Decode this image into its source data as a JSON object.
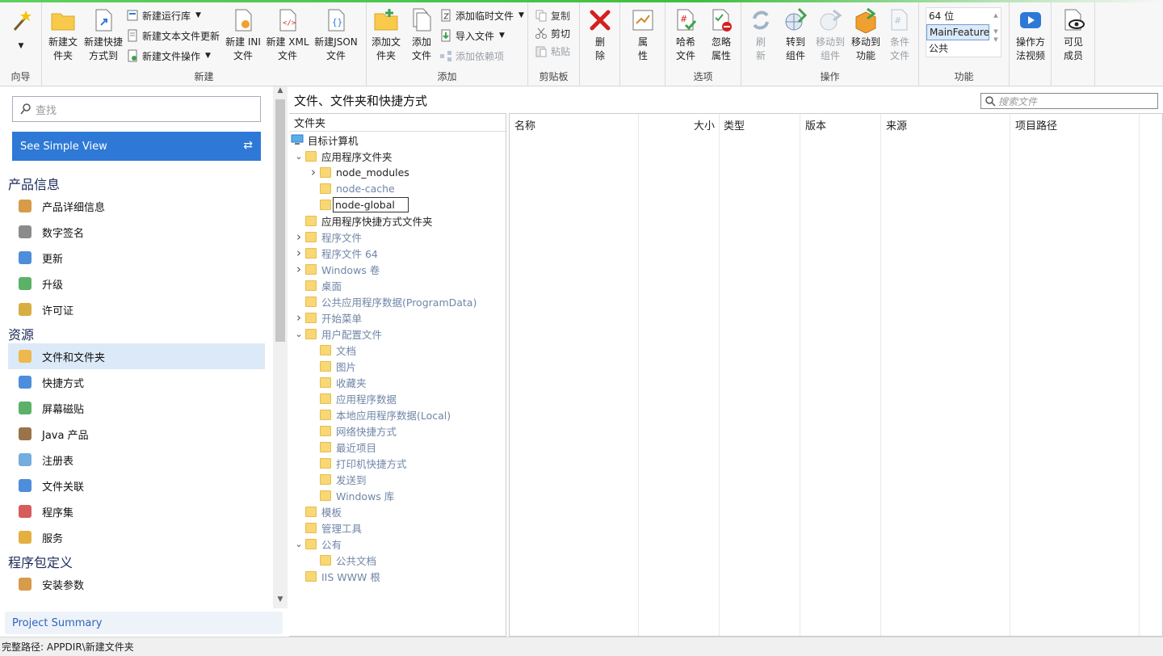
{
  "ribbon": {
    "wizard": {
      "label": "向导"
    },
    "new_group": {
      "label": "新建",
      "new_folder": "新建文\n件夹",
      "new_shortcut": "新建快捷\n方式到",
      "new_runtime": "新建运行库",
      "new_text_update": "新建文本文件更新",
      "new_file_op": "新建文件操作",
      "new_ini": "新建 INI\n文件",
      "new_xml": "新建 XML\n文件",
      "new_json": "新建JSON\n文件"
    },
    "add_group": {
      "label": "添加",
      "add_folder": "添加文\n件夹",
      "add_file": "添加\n文件",
      "add_temp": "添加临时文件",
      "import_file": "导入文件",
      "add_dependency": "添加依赖项"
    },
    "clipboard": {
      "label": "剪贴板",
      "copy": "复制",
      "cut": "剪切",
      "paste": "粘贴"
    },
    "delete": "删\n除",
    "properties": "属\n性",
    "options": {
      "label": "选项",
      "hash": "哈希\n文件",
      "ignore": "忽略\n属性"
    },
    "actions": {
      "label": "操作",
      "refresh": "刷\n新",
      "goto_component": "转到\n组件",
      "move_component": "移动到\n组件",
      "move_feature": "移动到\n功能",
      "condition": "条件\n文件"
    },
    "features": {
      "label": "功能",
      "items": [
        "64 位",
        "MainFeature",
        "公共"
      ]
    },
    "video": "操作方\n法视频",
    "visible_members": "可见\n成员"
  },
  "sidebar": {
    "search_placeholder": "查找",
    "simple_view": "See Simple View",
    "sections": [
      {
        "title": "产品信息",
        "items": [
          "产品详细信息",
          "数字签名",
          "更新",
          "升级",
          "许可证"
        ]
      },
      {
        "title": "资源",
        "items": [
          "文件和文件夹",
          "快捷方式",
          "屏幕磁贴",
          "Java 产品",
          "注册表",
          "文件关联",
          "程序集",
          "服务"
        ]
      },
      {
        "title": "程序包定义",
        "items": [
          "安装参数"
        ]
      }
    ],
    "project_summary": "Project Summary"
  },
  "main": {
    "title": "文件、文件夹和快捷方式",
    "search_placeholder": "搜索文件",
    "tree_header": "文件夹",
    "tree": [
      {
        "label": "目标计算机",
        "level": 0,
        "exp": "",
        "type": "computer",
        "dim": false
      },
      {
        "label": "应用程序文件夹",
        "level": 1,
        "exp": "v",
        "type": "folder",
        "dim": false
      },
      {
        "label": "node_modules",
        "level": 2,
        "exp": ">",
        "type": "folder",
        "dim": false
      },
      {
        "label": "node-cache",
        "level": 2,
        "exp": "",
        "type": "folder",
        "dim": true
      },
      {
        "label": "node-global",
        "level": 2,
        "exp": "",
        "type": "edit",
        "dim": false
      },
      {
        "label": "应用程序快捷方式文件夹",
        "level": 1,
        "exp": "",
        "type": "folder",
        "dim": false
      },
      {
        "label": "程序文件",
        "level": 1,
        "exp": ">",
        "type": "folder",
        "dim": true
      },
      {
        "label": "程序文件 64",
        "level": 1,
        "exp": ">",
        "type": "folder",
        "dim": true
      },
      {
        "label": "Windows 卷",
        "level": 1,
        "exp": ">",
        "type": "folder",
        "dim": true
      },
      {
        "label": "桌面",
        "level": 1,
        "exp": "",
        "type": "folder",
        "dim": true
      },
      {
        "label": "公共应用程序数据(ProgramData)",
        "level": 1,
        "exp": "",
        "type": "folder",
        "dim": true
      },
      {
        "label": "开始菜单",
        "level": 1,
        "exp": ">",
        "type": "folder",
        "dim": true
      },
      {
        "label": "用户配置文件",
        "level": 1,
        "exp": "v",
        "type": "folder",
        "dim": true
      },
      {
        "label": "文档",
        "level": 2,
        "exp": "",
        "type": "folder",
        "dim": true
      },
      {
        "label": "图片",
        "level": 2,
        "exp": "",
        "type": "folder",
        "dim": true
      },
      {
        "label": "收藏夹",
        "level": 2,
        "exp": "",
        "type": "folder",
        "dim": true
      },
      {
        "label": "应用程序数据",
        "level": 2,
        "exp": "",
        "type": "folder",
        "dim": true
      },
      {
        "label": "本地应用程序数据(Local)",
        "level": 2,
        "exp": "",
        "type": "folder",
        "dim": true
      },
      {
        "label": "网络快捷方式",
        "level": 2,
        "exp": "",
        "type": "folder",
        "dim": true
      },
      {
        "label": "最近项目",
        "level": 2,
        "exp": "",
        "type": "folder",
        "dim": true
      },
      {
        "label": "打印机快捷方式",
        "level": 2,
        "exp": "",
        "type": "folder",
        "dim": true
      },
      {
        "label": "发送到",
        "level": 2,
        "exp": "",
        "type": "folder",
        "dim": true
      },
      {
        "label": "Windows 库",
        "level": 2,
        "exp": "",
        "type": "folder",
        "dim": true
      },
      {
        "label": "模板",
        "level": 1,
        "exp": "",
        "type": "folder",
        "dim": true
      },
      {
        "label": "管理工具",
        "level": 1,
        "exp": "",
        "type": "folder",
        "dim": true
      },
      {
        "label": "公有",
        "level": 1,
        "exp": "v",
        "type": "folder",
        "dim": true
      },
      {
        "label": "公共文档",
        "level": 2,
        "exp": "",
        "type": "folder",
        "dim": true
      },
      {
        "label": "IIS WWW 根",
        "level": 1,
        "exp": "",
        "type": "folder",
        "dim": true
      }
    ],
    "columns": [
      "名称",
      "大小",
      "类型",
      "版本",
      "来源",
      "项目路径"
    ]
  },
  "status": "完整路径: APPDIR\\新建文件夹",
  "colors": {
    "accent": "#2f79d6",
    "topline": "#3fbf3f",
    "selected": "#dce9f8"
  }
}
